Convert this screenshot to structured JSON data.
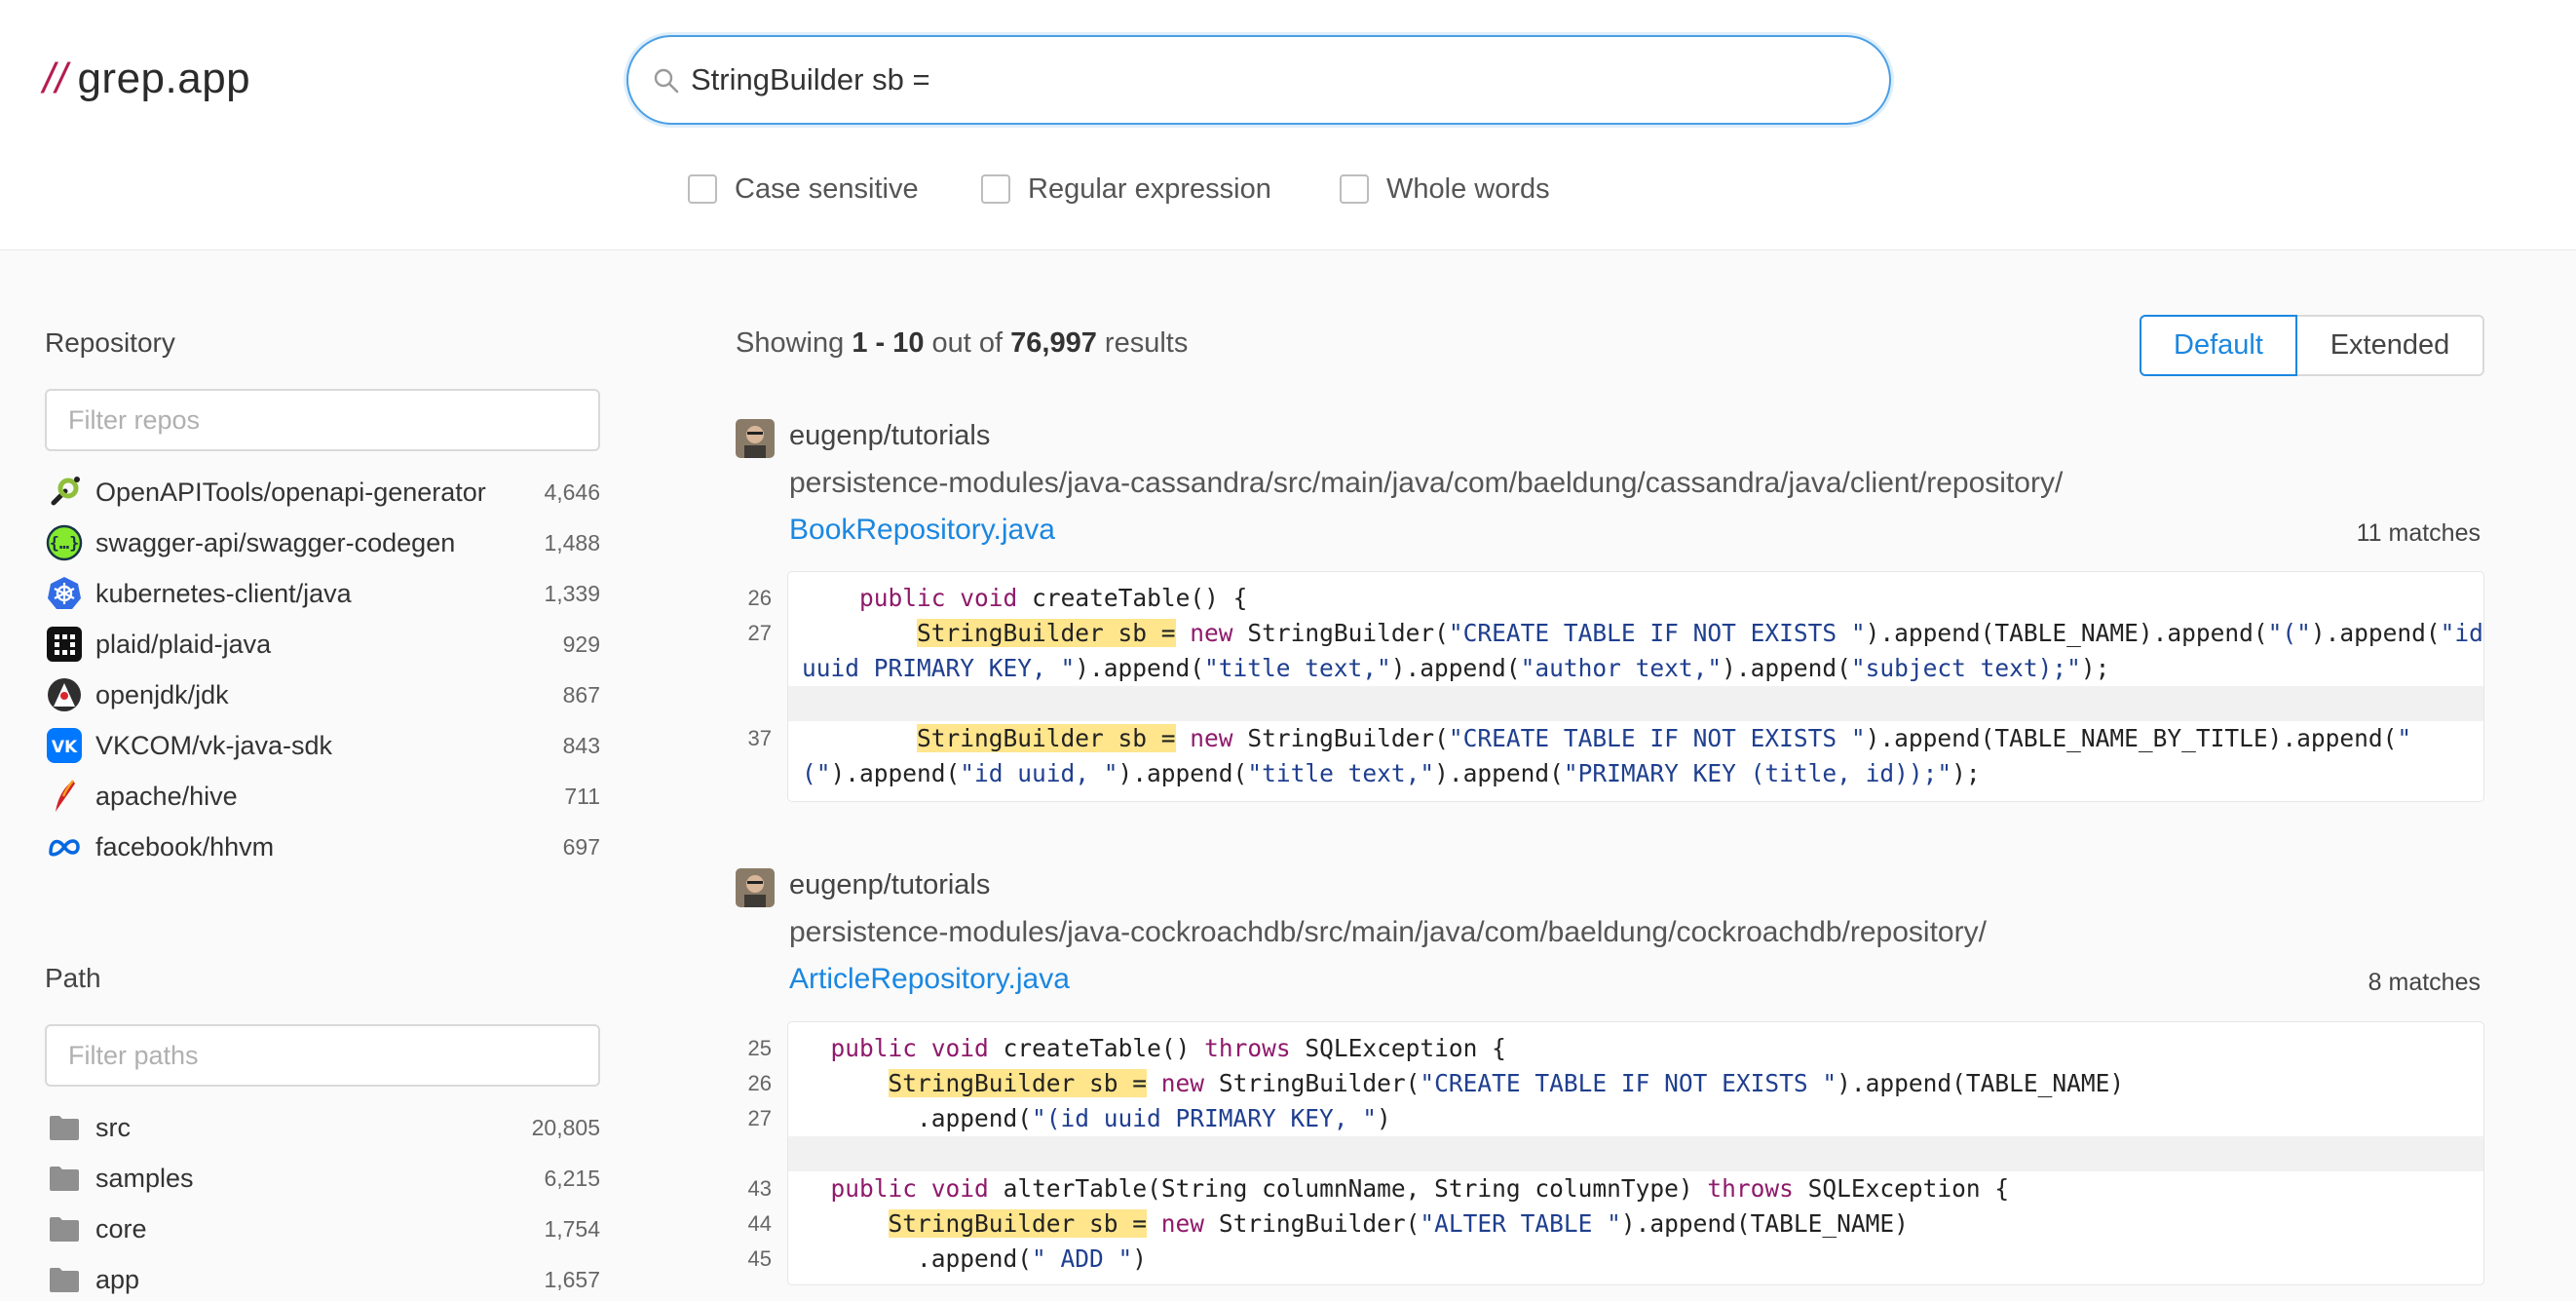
{
  "header": {
    "logo_slash": "//",
    "logo_name": "grep.app",
    "search": {
      "value": "StringBuilder sb =",
      "icon": "search-icon"
    },
    "options": [
      "Case sensitive",
      "Regular expression",
      "Whole words"
    ]
  },
  "sidebar": {
    "repository": {
      "heading": "Repository",
      "placeholder": "Filter repos",
      "items": [
        {
          "name": "OpenAPITools/openapi-generator",
          "count": "4,646",
          "icon": "openapi-generator-logo"
        },
        {
          "name": "swagger-api/swagger-codegen",
          "count": "1,488",
          "icon": "swagger-logo"
        },
        {
          "name": "kubernetes-client/java",
          "count": "1,339",
          "icon": "kubernetes-logo"
        },
        {
          "name": "plaid/plaid-java",
          "count": "929",
          "icon": "plaid-logo"
        },
        {
          "name": "openjdk/jdk",
          "count": "867",
          "icon": "openjdk-duke-logo"
        },
        {
          "name": "VKCOM/vk-java-sdk",
          "count": "843",
          "icon": "vk-logo"
        },
        {
          "name": "apache/hive",
          "count": "711",
          "icon": "apache-feather-logo"
        },
        {
          "name": "facebook/hhvm",
          "count": "697",
          "icon": "meta-logo"
        }
      ]
    },
    "path": {
      "heading": "Path",
      "placeholder": "Filter paths",
      "items": [
        {
          "name": "src",
          "count": "20,805",
          "icon": "folder-icon"
        },
        {
          "name": "samples",
          "count": "6,215",
          "icon": "folder-icon"
        },
        {
          "name": "core",
          "count": "1,754",
          "icon": "folder-icon"
        },
        {
          "name": "app",
          "count": "1,657",
          "icon": "folder-icon"
        }
      ]
    }
  },
  "results": {
    "showing_prefix": "Showing ",
    "range": "1 - 10",
    "out_of": " out of ",
    "total": "76,997",
    "suffix": " results",
    "view_default": "Default",
    "view_extended": "Extended",
    "items": [
      {
        "repo": "eugenp/tutorials",
        "path": "persistence-modules/java-cassandra/src/main/java/com/baeldung/cassandra/java/client/repository/",
        "file": "BookRepository.java",
        "matches": "11 matches",
        "line_numbers": [
          "26",
          "27",
          "37"
        ],
        "code": [
          "    public void createTable() {",
          "        StringBuilder sb = new StringBuilder(\"CREATE TABLE IF NOT EXISTS \").append(TABLE_NAME).append(\"(\").append(\"id",
          "uuid PRIMARY KEY, \").append(\"title text,\").append(\"author text,\").append(\"subject text);\");",
          "        StringBuilder sb = new StringBuilder(\"CREATE TABLE IF NOT EXISTS \").append(TABLE_NAME_BY_TITLE).append(\"",
          "(\").append(\"id uuid, \").append(\"title text,\").append(\"PRIMARY KEY (title, id));\");"
        ]
      },
      {
        "repo": "eugenp/tutorials",
        "path": "persistence-modules/java-cockroachdb/src/main/java/com/baeldung/cockroachdb/repository/",
        "file": "ArticleRepository.java",
        "matches": "8 matches",
        "line_numbers": [
          "25",
          "26",
          "27",
          "43",
          "44",
          "45"
        ],
        "code": [
          "public void createTable() throws SQLException {",
          "    StringBuilder sb = new StringBuilder(\"CREATE TABLE IF NOT EXISTS \").append(TABLE_NAME)",
          "      .append(\"(id uuid PRIMARY KEY, \")",
          "public void alterTable(String columnName, String columnType) throws SQLException {",
          "    StringBuilder sb = new StringBuilder(\"ALTER TABLE \").append(TABLE_NAME)",
          "      .append(\" ADD \")"
        ]
      }
    ]
  },
  "colors": {
    "accent": "#1b87e0",
    "logo_slash": "#b31d52",
    "highlight": "#ffe58c",
    "keyword": "#8f1a6b",
    "string": "#1f3f8f"
  }
}
